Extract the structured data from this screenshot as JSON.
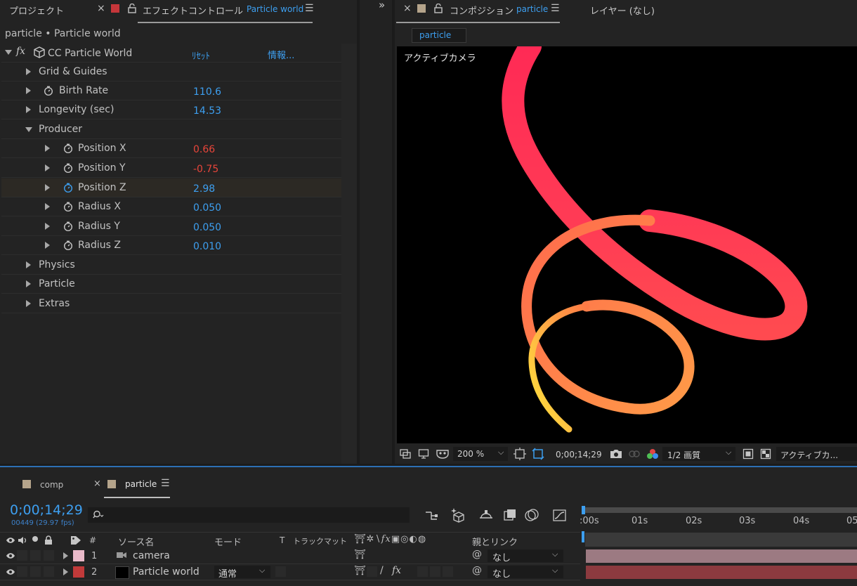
{
  "project_panel": {
    "tab_label": "プロジェクト",
    "close": "×"
  },
  "effects_panel": {
    "tab_label": "エフェクトコントロール",
    "tab_layer": "Particle world",
    "breadcrumb": "particle • Particle world",
    "effect": {
      "fx": "fx",
      "name": "CC Particle World",
      "reset": "ﾘｾｯﾄ",
      "info": "情報..."
    },
    "props": [
      {
        "label": "Grid & Guides",
        "value": ""
      },
      {
        "label": "Birth Rate",
        "value": "110.6"
      },
      {
        "label": "Longevity (sec)",
        "value": "14.53"
      },
      {
        "label": "Producer",
        "value": ""
      },
      {
        "label": "Position X",
        "value": "0.66"
      },
      {
        "label": "Position Y",
        "value": "-0.75"
      },
      {
        "label": "Position Z",
        "value": "2.98"
      },
      {
        "label": "Radius X",
        "value": "0.050"
      },
      {
        "label": "Radius Y",
        "value": "0.050"
      },
      {
        "label": "Radius Z",
        "value": "0.010"
      },
      {
        "label": "Physics",
        "value": ""
      },
      {
        "label": "Particle",
        "value": ""
      },
      {
        "label": "Extras",
        "value": ""
      }
    ]
  },
  "composition_panel": {
    "tab_label": "コンポジション",
    "tab_comp": "particle",
    "layer_tab": "レイヤー (なし)",
    "subtab": "particle",
    "camera_label": "アクティブカメラ",
    "zoom": "200 %",
    "timecode": "0;00;14;29",
    "resolution": "1/2 画質",
    "view": "アクティブカ..."
  },
  "timeline": {
    "tabs": [
      {
        "label": "comp"
      },
      {
        "label": "particle"
      }
    ],
    "timecode": "0;00;14;29",
    "frame_info": "00449 (29.97 fps)",
    "columns": {
      "num": "#",
      "source": "ソース名",
      "mode": "モード",
      "t": "T",
      "trackmatte": "トラックマット",
      "parent": "親とリンク"
    },
    "ruler": [
      ":00s",
      "01s",
      "02s",
      "03s",
      "04s",
      "05"
    ],
    "layers": [
      {
        "num": "1",
        "name": "camera",
        "mode": "",
        "parent": "なし",
        "color": "#e9b9c9"
      },
      {
        "num": "2",
        "name": "Particle world",
        "mode": "通常",
        "parent": "なし",
        "color": "#c13a3a"
      }
    ]
  }
}
